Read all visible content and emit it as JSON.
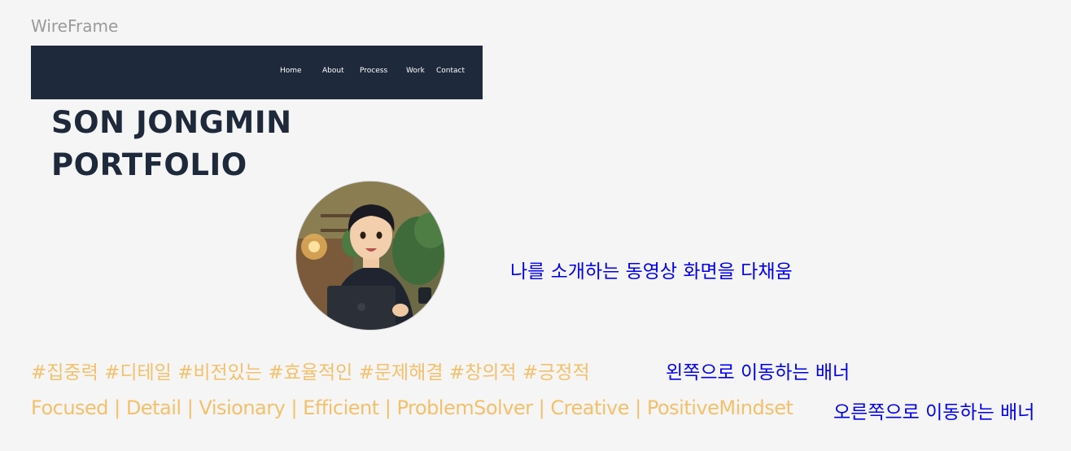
{
  "frame_label": "WireFrame",
  "nav": {
    "items": [
      {
        "label": "Home"
      },
      {
        "label": "About"
      },
      {
        "label": "Process"
      },
      {
        "label": "Work"
      },
      {
        "label": "Contact"
      }
    ]
  },
  "hero": {
    "title_line1": "SON JONGMIN",
    "title_line2": "PORTFOLIO"
  },
  "profile": {
    "avatar_icon": "profile-illustration"
  },
  "notes": {
    "video_note": "나를 소개하는 동영상 화면을 다채움",
    "left_banner_note": "왼쪽으로 이동하는 배너",
    "right_banner_note": "오른쪽으로 이동하는 배너"
  },
  "banners": {
    "hashtags": "#집중력 #디테일 #비전있는 #효율적인 #문제해결 #창의적 #긍정적",
    "keywords": "Focused | Detail | Visionary | Efficient | ProblemSolver | Creative | PositiveMindset"
  },
  "colors": {
    "navbar_bg": "#1e293b",
    "title": "#1e293b",
    "banner_text": "#f4c06a",
    "note_text": "#0000ee",
    "background": "#f5f5f5"
  }
}
